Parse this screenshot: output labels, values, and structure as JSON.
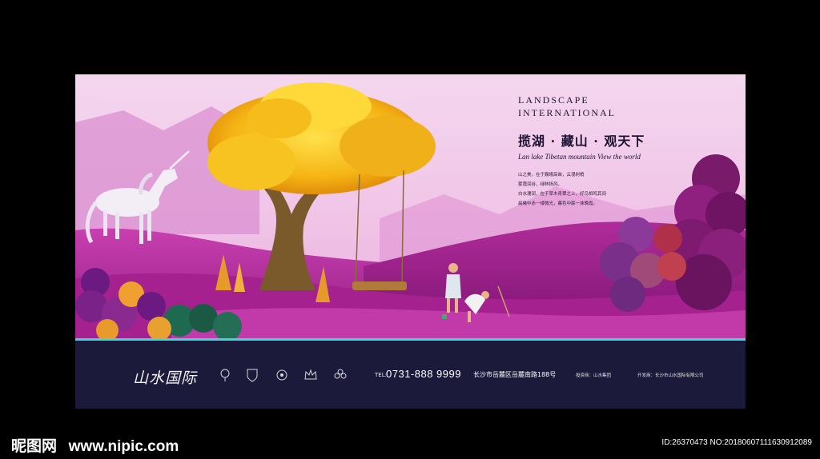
{
  "headline": {
    "en_title_line1": "LANDSCAPE",
    "en_title_line2": "INTERNATIONAL",
    "cn_slogan": "揽湖 · 藏山 · 观天下",
    "en_slogan": "Lan lake Tibetan mountain View the world",
    "body_lines": [
      "山之美，在于巍峨高耸，云漫树梢",
      "雾霭润谷，绿林扬风。",
      "白水濡润，在于草木青翠之上，好鸟相鸣其间",
      "晨曦中赤一缕微光，暮色中寐一抹晚霞。"
    ]
  },
  "footer": {
    "logo_text": "山水国际",
    "partner_icons": [
      "tree-crest-icon",
      "shield-crest-icon",
      "biohazard-crest-icon",
      "crown-crest-icon",
      "flower-crest-icon"
    ],
    "tel_label": "TEL:",
    "tel": "0731-888 9999",
    "address": "长沙市岳麓区岳麓南路188号",
    "developer_1": "投资商：山水集团",
    "developer_2": "开发商：长沙市山水国际有限公司",
    "accent": "#3fd6d6",
    "bar_color": "#1c1a3b"
  },
  "watermark": {
    "brand": "昵图网",
    "url": "www.nipic.com",
    "id_text": "ID:26370473 NO:20180607111630912089"
  }
}
